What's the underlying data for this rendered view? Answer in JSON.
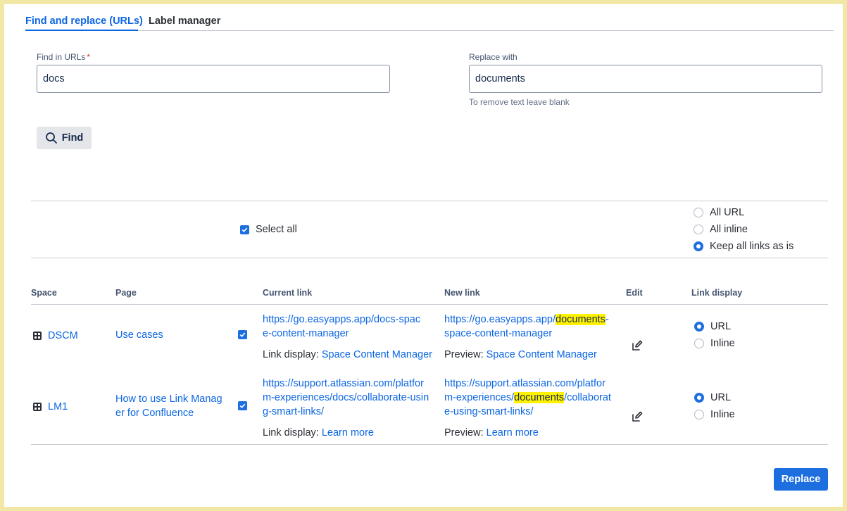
{
  "tabs": [
    {
      "label": "Find and replace (URLs)",
      "active": true
    },
    {
      "label": "Label manager",
      "active": false
    }
  ],
  "find_field": {
    "label": "Find in URLs",
    "required_mark": "*",
    "value": "docs"
  },
  "replace_field": {
    "label": "Replace with",
    "value": "documents",
    "hint": "To remove text leave blank"
  },
  "find_button": {
    "label": "Find",
    "icon": "search-icon"
  },
  "select_all": {
    "label": "Select all",
    "checked": true
  },
  "link_mode_options": [
    {
      "label": "All URL",
      "selected": false
    },
    {
      "label": "All inline",
      "selected": false
    },
    {
      "label": "Keep all links as is",
      "selected": true
    }
  ],
  "table": {
    "headers": {
      "space": "Space",
      "page": "Page",
      "current_link": "Current link",
      "new_link": "New link",
      "edit": "Edit",
      "link_display": "Link display"
    },
    "rows": [
      {
        "space": "DSCM",
        "page_lines": [
          "Use cases"
        ],
        "checked": true,
        "current_lines": [
          "https://go.easyapps.app/docs-spac",
          "e-content-manager"
        ],
        "current_display_label": "Link display:",
        "current_display_value": "Space Content Manager",
        "new_pre": "https://go.easyapps.app/",
        "new_highlight": "documents",
        "new_post": "-",
        "new_line2": "space-content-manager",
        "preview_label": "Preview:",
        "preview_value": "Space Content Manager",
        "display_options": [
          {
            "label": "URL",
            "selected": true
          },
          {
            "label": "Inline",
            "selected": false
          }
        ]
      },
      {
        "space": "LM1",
        "page_lines": [
          "How to use Link Manag",
          "er for Confluence"
        ],
        "checked": true,
        "current_lines": [
          "https://support.atlassian.com/platfor",
          "m-experiences/docs/collaborate-usin",
          "g-smart-links/"
        ],
        "current_display_label": "Link display:",
        "current_display_value": "Learn more",
        "new_line1": "https://support.atlassian.com/platfor",
        "new_pre": "m-experiences/",
        "new_highlight": "documents",
        "new_post": "/collaborat",
        "new_line3": "e-using-smart-links/",
        "preview_label": "Preview:",
        "preview_value": "Learn more",
        "display_options": [
          {
            "label": "URL",
            "selected": true
          },
          {
            "label": "Inline",
            "selected": false
          }
        ]
      }
    ]
  },
  "replace_button": {
    "label": "Replace"
  },
  "colors": {
    "accent": "#1d6fe0",
    "highlight": "#fff200",
    "frame": "#f1e8a6"
  }
}
